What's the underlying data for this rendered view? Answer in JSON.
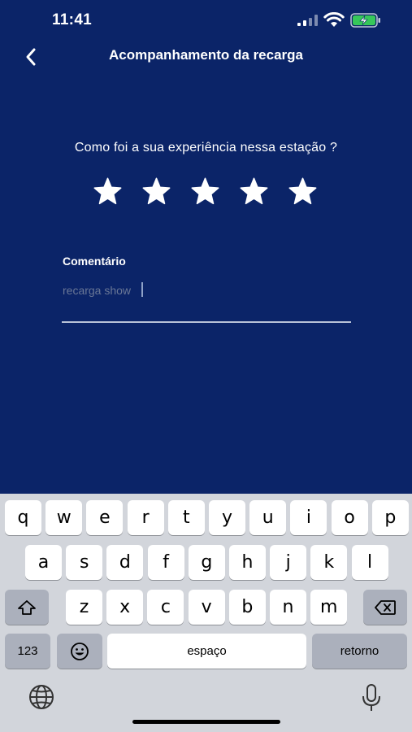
{
  "status_bar": {
    "time": "11:41"
  },
  "header": {
    "title": "Acompanhamento da recarga"
  },
  "rating": {
    "question": "Como foi a sua experiência nessa estação ?",
    "value": 5,
    "max": 5
  },
  "comment": {
    "label": "Comentário",
    "value": "recarga show"
  },
  "keyboard": {
    "row1": [
      "q",
      "w",
      "e",
      "r",
      "t",
      "y",
      "u",
      "i",
      "o",
      "p"
    ],
    "row2": [
      "a",
      "s",
      "d",
      "f",
      "g",
      "h",
      "j",
      "k",
      "l"
    ],
    "row3": [
      "z",
      "x",
      "c",
      "v",
      "b",
      "n",
      "m"
    ],
    "numbers_label": "123",
    "space_label": "espaço",
    "return_label": "retorno"
  },
  "colors": {
    "background": "#0b2468",
    "keyboard": "#d2d5db",
    "accent": "#ffffff"
  }
}
